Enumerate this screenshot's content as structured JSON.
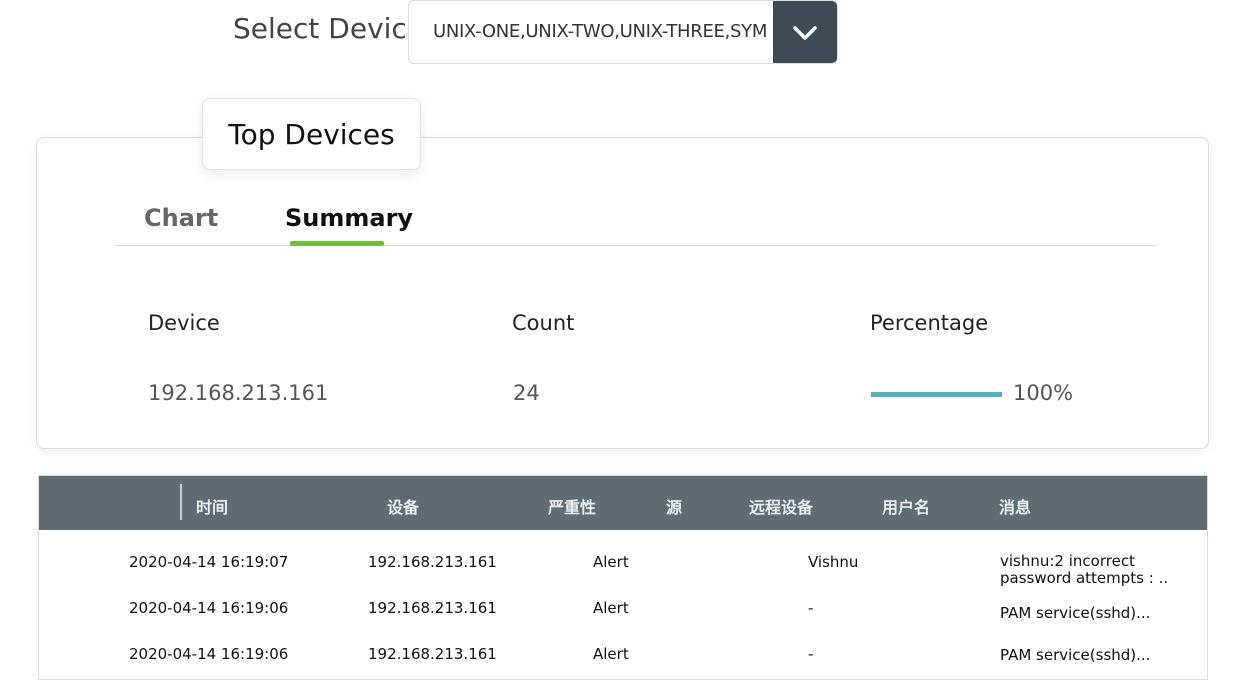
{
  "select": {
    "label": "Select Device",
    "value": "UNIX-ONE,UNIX-TWO,UNIX-THREE,SYM"
  },
  "card": {
    "title": "Top Devices",
    "tabs": [
      {
        "label": "Chart",
        "active": false
      },
      {
        "label": "Summary",
        "active": true
      }
    ],
    "columns": [
      "Device",
      "Count",
      "Percentage"
    ],
    "row": {
      "device": "192.168.213.161",
      "count": "24",
      "percentage_label": "100%",
      "percentage_value": 100
    }
  },
  "table": {
    "headers": [
      "时间",
      "设备",
      "严重性",
      "源",
      "远程设备",
      "用户名",
      "消息"
    ],
    "rows": [
      {
        "time": "2020-04-14 16:19:07",
        "device": "192.168.213.161",
        "severity": "Alert",
        "user": "Vishnu",
        "message": "vishnu:2 incorrect password attempts : .."
      },
      {
        "time": "2020-04-14 16:19:06",
        "device": "192.168.213.161",
        "severity": "Alert",
        "user": "-",
        "message": "PAM service(sshd)..."
      },
      {
        "time": "2020-04-14 16:19:06",
        "device": "192.168.213.161",
        "severity": "Alert",
        "user": "-",
        "message": "PAM service(sshd)..."
      }
    ]
  },
  "colors": {
    "accent_green": "#6fbf3a",
    "bar_teal": "#4fb3bd",
    "header_gray": "#5f6c73",
    "dropdown_dark": "#3f4b54"
  }
}
